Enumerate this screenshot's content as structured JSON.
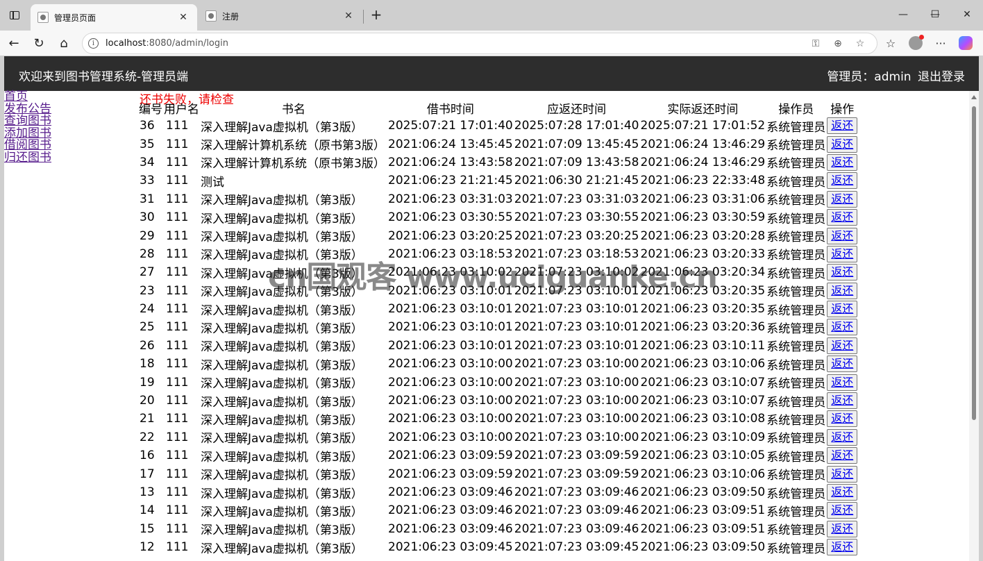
{
  "browser": {
    "tabs": [
      {
        "title": "管理员页面",
        "active": true
      },
      {
        "title": "注册",
        "active": false
      }
    ],
    "url_host": "localhost",
    "url_rest": ":8080/admin/login"
  },
  "header": {
    "brand": "欢迎来到图书管理系统-管理员端",
    "user_label": "管理员：admin",
    "logout": "退出登录"
  },
  "nav": [
    "首页",
    "发布公告",
    "查询图书",
    "添加图书",
    "借阅图书",
    "归还图书"
  ],
  "message": "还书失败，请检查",
  "table": {
    "headers": [
      "编号",
      "用户名",
      "书名",
      "借书时间",
      "应返还时间",
      "实际返还时间",
      "操作员",
      "操作"
    ],
    "button_label": "返还",
    "rows": [
      [
        "36",
        "111",
        "深入理解Java虚拟机（第3版）",
        "2025:07:21 17:01:40",
        "2025:07:28 17:01:40",
        "2025:07:21 17:01:52",
        "系统管理员"
      ],
      [
        "35",
        "111",
        "深入理解计算机系统（原书第3版）",
        "2021:06:24 13:45:45",
        "2021:07:09 13:45:45",
        "2021:06:24 13:46:29",
        "系统管理员"
      ],
      [
        "34",
        "111",
        "深入理解计算机系统（原书第3版）",
        "2021:06:24 13:43:58",
        "2021:07:09 13:43:58",
        "2021:06:24 13:46:29",
        "系统管理员"
      ],
      [
        "33",
        "111",
        "测试",
        "2021:06:23 21:21:45",
        "2021:06:30 21:21:45",
        "2021:06:23 22:33:48",
        "系统管理员"
      ],
      [
        "31",
        "111",
        "深入理解Java虚拟机（第3版）",
        "2021:06:23 03:31:03",
        "2021:07:23 03:31:03",
        "2021:06:23 03:31:06",
        "系统管理员"
      ],
      [
        "30",
        "111",
        "深入理解Java虚拟机（第3版）",
        "2021:06:23 03:30:55",
        "2021:07:23 03:30:55",
        "2021:06:23 03:30:59",
        "系统管理员"
      ],
      [
        "29",
        "111",
        "深入理解Java虚拟机（第3版）",
        "2021:06:23 03:20:25",
        "2021:07:23 03:20:25",
        "2021:06:23 03:20:28",
        "系统管理员"
      ],
      [
        "28",
        "111",
        "深入理解Java虚拟机（第3版）",
        "2021:06:23 03:18:53",
        "2021:07:23 03:18:53",
        "2021:06:23 03:20:33",
        "系统管理员"
      ],
      [
        "27",
        "111",
        "深入理解Java虚拟机（第3版）",
        "2021:06:23 03:10:02",
        "2021:07:23 03:10:02",
        "2021:06:23 03:20:34",
        "系统管理员"
      ],
      [
        "23",
        "111",
        "深入理解Java虚拟机（第3版）",
        "2021:06:23 03:10:01",
        "2021:07:23 03:10:01",
        "2021:06:23 03:20:35",
        "系统管理员"
      ],
      [
        "24",
        "111",
        "深入理解Java虚拟机（第3版）",
        "2021:06:23 03:10:01",
        "2021:07:23 03:10:01",
        "2021:06:23 03:20:35",
        "系统管理员"
      ],
      [
        "25",
        "111",
        "深入理解Java虚拟机（第3版）",
        "2021:06:23 03:10:01",
        "2021:07:23 03:10:01",
        "2021:06:23 03:20:36",
        "系统管理员"
      ],
      [
        "26",
        "111",
        "深入理解Java虚拟机（第3版）",
        "2021:06:23 03:10:01",
        "2021:07:23 03:10:01",
        "2021:06:23 03:10:11",
        "系统管理员"
      ],
      [
        "18",
        "111",
        "深入理解Java虚拟机（第3版）",
        "2021:06:23 03:10:00",
        "2021:07:23 03:10:00",
        "2021:06:23 03:10:06",
        "系统管理员"
      ],
      [
        "19",
        "111",
        "深入理解Java虚拟机（第3版）",
        "2021:06:23 03:10:00",
        "2021:07:23 03:10:00",
        "2021:06:23 03:10:07",
        "系统管理员"
      ],
      [
        "20",
        "111",
        "深入理解Java虚拟机（第3版）",
        "2021:06:23 03:10:00",
        "2021:07:23 03:10:00",
        "2021:06:23 03:10:07",
        "系统管理员"
      ],
      [
        "21",
        "111",
        "深入理解Java虚拟机（第3版）",
        "2021:06:23 03:10:00",
        "2021:07:23 03:10:00",
        "2021:06:23 03:10:08",
        "系统管理员"
      ],
      [
        "22",
        "111",
        "深入理解Java虚拟机（第3版）",
        "2021:06:23 03:10:00",
        "2021:07:23 03:10:00",
        "2021:06:23 03:10:09",
        "系统管理员"
      ],
      [
        "16",
        "111",
        "深入理解Java虚拟机（第3版）",
        "2021:06:23 03:09:59",
        "2021:07:23 03:09:59",
        "2021:06:23 03:10:05",
        "系统管理员"
      ],
      [
        "17",
        "111",
        "深入理解Java虚拟机（第3版）",
        "2021:06:23 03:09:59",
        "2021:07:23 03:09:59",
        "2021:06:23 03:10:06",
        "系统管理员"
      ],
      [
        "13",
        "111",
        "深入理解Java虚拟机（第3版）",
        "2021:06:23 03:09:46",
        "2021:07:23 03:09:46",
        "2021:06:23 03:09:50",
        "系统管理员"
      ],
      [
        "14",
        "111",
        "深入理解Java虚拟机（第3版）",
        "2021:06:23 03:09:46",
        "2021:07:23 03:09:46",
        "2021:06:23 03:09:51",
        "系统管理员"
      ],
      [
        "15",
        "111",
        "深入理解Java虚拟机（第3版）",
        "2021:06:23 03:09:46",
        "2021:07:23 03:09:46",
        "2021:06:23 03:09:51",
        "系统管理员"
      ],
      [
        "12",
        "111",
        "深入理解Java虚拟机（第3版）",
        "2021:06:23 03:09:45",
        "2021:07:23 03:09:45",
        "2021:06:23 03:09:50",
        "系统管理员"
      ]
    ]
  },
  "watermark": "cn国观客 www.uciguanke.cn",
  "colors": {
    "header_bg": "#2d2d2d",
    "error_text": "#ee0000",
    "visited_link": "#551a8b",
    "button_link": "#0000ee"
  }
}
